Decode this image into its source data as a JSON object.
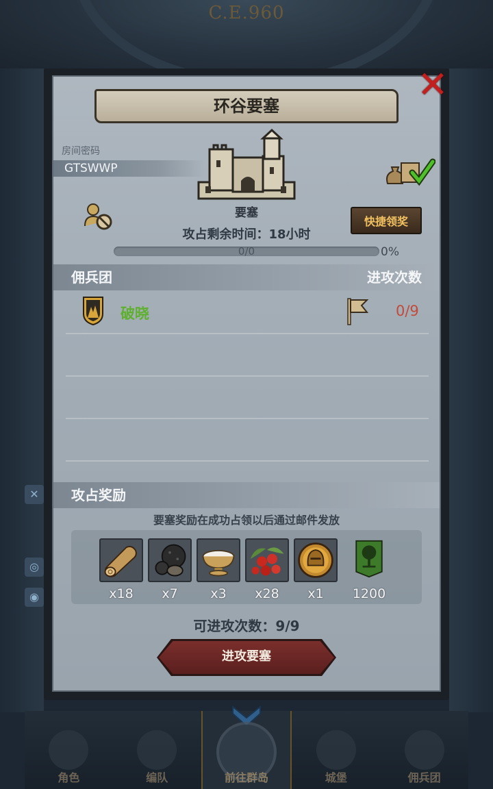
{
  "background": {
    "era_text": "C.E.960"
  },
  "popup": {
    "title": "环谷要塞",
    "room_label": "房间密码",
    "room_code": "GTSWWP",
    "building_label": "要塞",
    "quick_claim_label": "快捷领奖",
    "time_remaining": "攻占剩余时间：18小时",
    "progress": {
      "text": "0/0",
      "percent_text": "0%",
      "fraction": 0
    },
    "mercenary_header": "佣兵团",
    "attack_count_header": "进攻次数",
    "guild": {
      "name": "破晓",
      "attacks": "0/9"
    },
    "reward_header": "攻占奖励",
    "reward_note": "要塞奖励在成功占领以后通过邮件发放",
    "rewards": [
      {
        "icon": "wood-log-icon",
        "qty": "x18"
      },
      {
        "icon": "truffle-icon",
        "qty": "x7"
      },
      {
        "icon": "milk-bowl-icon",
        "qty": "x3"
      },
      {
        "icon": "berries-icon",
        "qty": "x28"
      },
      {
        "icon": "knight-helmet-medal-icon",
        "qty": "x1"
      },
      {
        "icon": "tree-banner-icon",
        "qty": "1200"
      }
    ],
    "available_attacks": "可进攻次数：9/9",
    "attack_button": "进攻要塞"
  },
  "bottom_nav": [
    {
      "label": "角色",
      "active": false
    },
    {
      "label": "编队",
      "active": false
    },
    {
      "label": "前往群岛",
      "active": true
    },
    {
      "label": "城堡",
      "active": false
    },
    {
      "label": "佣兵团",
      "active": false
    }
  ],
  "colors": {
    "guild_name": "#5fb02f",
    "attack_count": "#c24a3a",
    "quick_claim_text": "#f0c060",
    "close_icon": "#c41f1f"
  }
}
